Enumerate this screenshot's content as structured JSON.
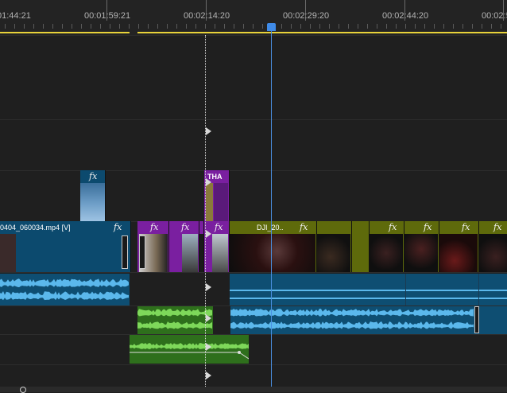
{
  "ruler": {
    "timecodes": [
      "01:44:21",
      "00:01:59:21",
      "00:02:14:20",
      "00:02:29:20",
      "00:02:44:20",
      "00:02:5"
    ]
  },
  "clips": {
    "small_fx": "fx",
    "title_clip": "THA",
    "main_clip_name": "0404_060034.mp4 [V]",
    "main_fx": "fx",
    "dji_clip_name": "DJI_20..",
    "fx_label": "fx"
  },
  "icons": {
    "fx": "fx-badge-icon",
    "marker": "edit-point-marker-icon",
    "playhead": "playhead-icon"
  },
  "colors": {
    "video_clip": "#0c4a6e",
    "fx_clip": "#7a1fa0",
    "dji_clip": "#5e6a0b",
    "audio_blue": "#0e4e72",
    "audio_green": "#2e6f1c",
    "playhead": "#3f8be8",
    "work_area": "#e8d33a"
  }
}
